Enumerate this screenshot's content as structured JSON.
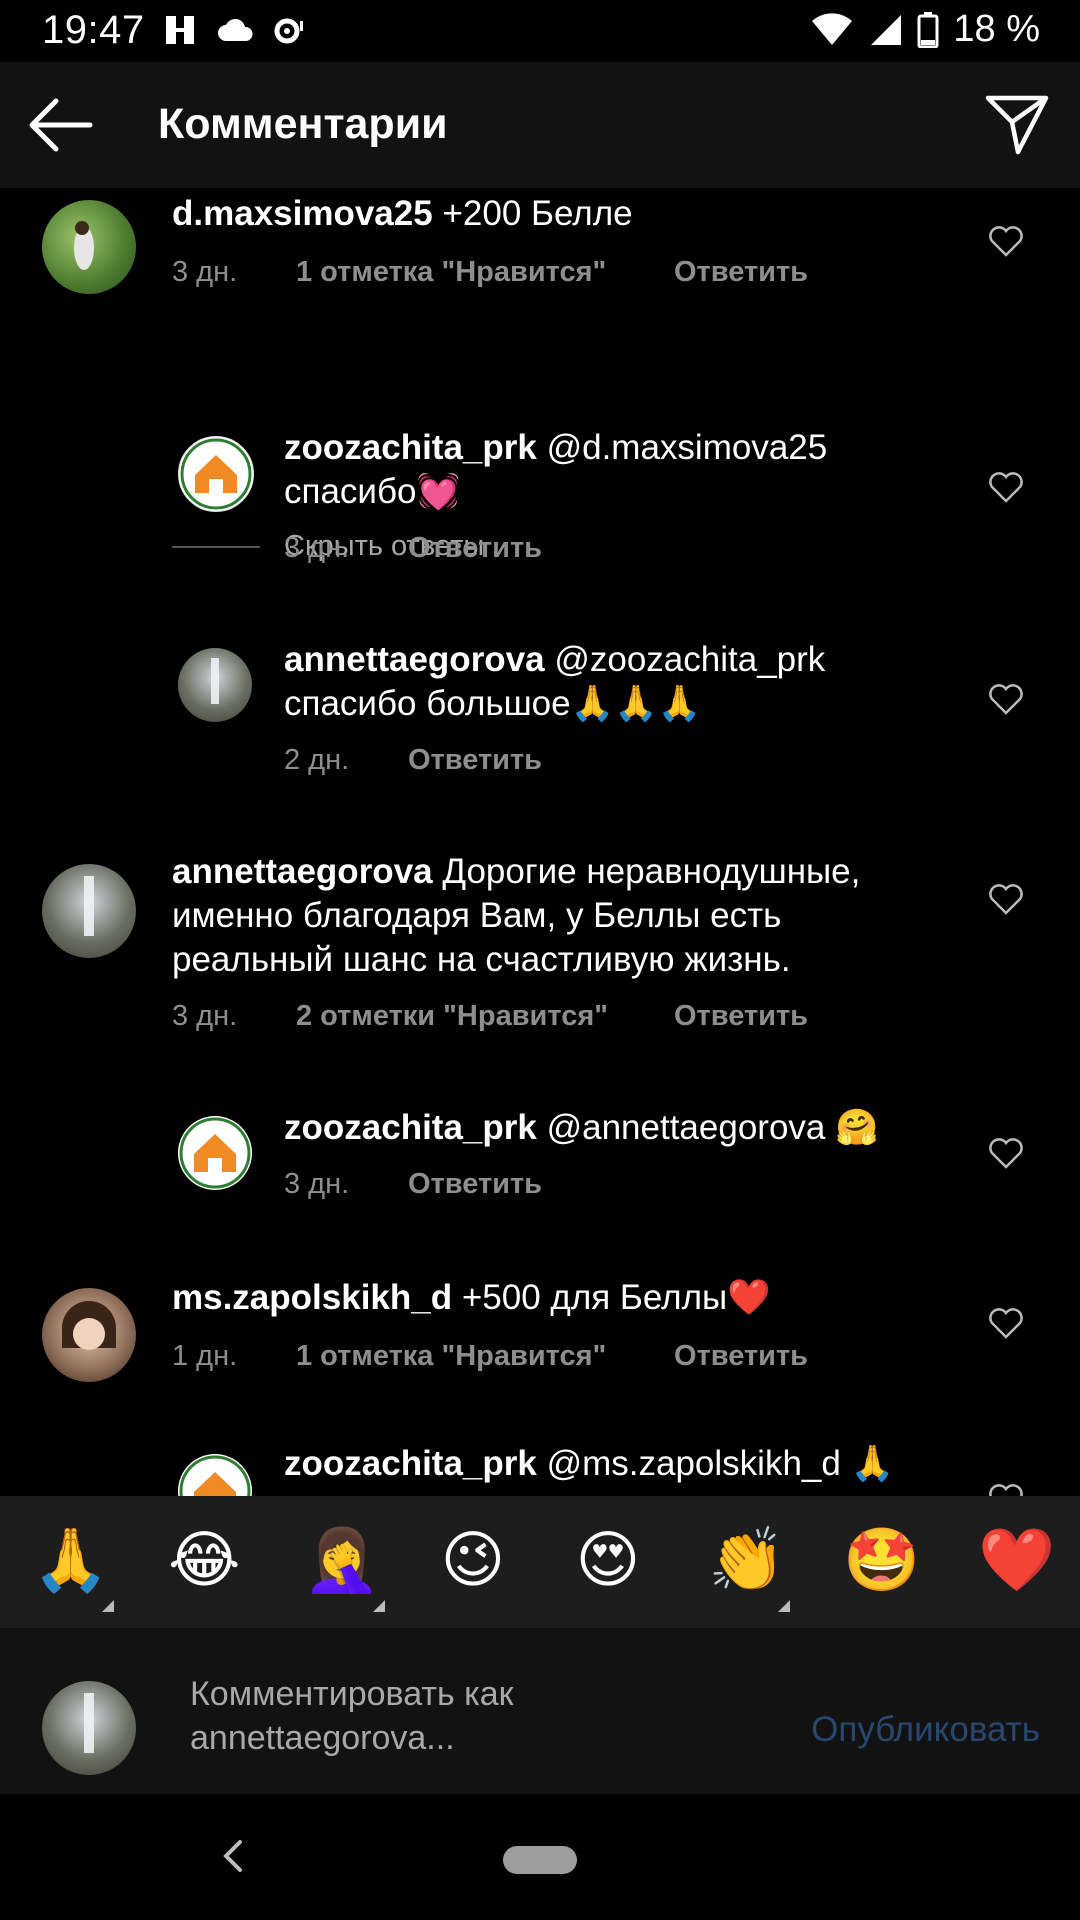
{
  "status_bar": {
    "time": "19:47",
    "battery": "18 %"
  },
  "app_bar": {
    "title": "Комментарии"
  },
  "comments": [
    {
      "username": "d.maxsimova25",
      "text": " +200 Белле",
      "time": "3 дн.",
      "likes": "1 отметка \"Нравится\"",
      "reply": "Ответить"
    },
    {
      "username": "zoozachita_prk",
      "text": " @d.maxsimova25 спасибо💓",
      "time": "3 дн.",
      "reply": "Ответить"
    },
    {
      "username": "annettaegorova",
      "text": " @zoozachita_prk спасибо большое🙏🙏🙏",
      "time": "2 дн.",
      "reply": "Ответить"
    },
    {
      "username": "annettaegorova",
      "text": " Дорогие неравнодушные, именно благодаря Вам, у Беллы есть реальный шанс на счастливую жизнь.",
      "time": "3 дн.",
      "likes": "2 отметки \"Нравится\"",
      "reply": "Ответить"
    },
    {
      "username": "zoozachita_prk",
      "text": " @annettaegorova 🤗",
      "time": "3 дн.",
      "reply": "Ответить"
    },
    {
      "username": "ms.zapolskikh_d",
      "text": " +500 для Беллы❤️",
      "time": "1 дн.",
      "likes": "1 отметка \"Нравится\"",
      "reply": "Ответить"
    },
    {
      "username": "zoozachita_prk",
      "text": " @ms.zapolskikh_d 🙏"
    }
  ],
  "hide_replies": "Скрыть ответы",
  "emoji_bar": [
    "🙏",
    "😂",
    "🤦‍♀️",
    "😉",
    "😍",
    "👏",
    "🤩",
    "❤️"
  ],
  "composer": {
    "placeholder": "Комментировать как annettaegorova...",
    "publish_label": "Опубликовать"
  },
  "colors": {
    "background": "#000000",
    "bar": "#121212",
    "muted": "#8e8e8e",
    "publish": "#28486f"
  }
}
